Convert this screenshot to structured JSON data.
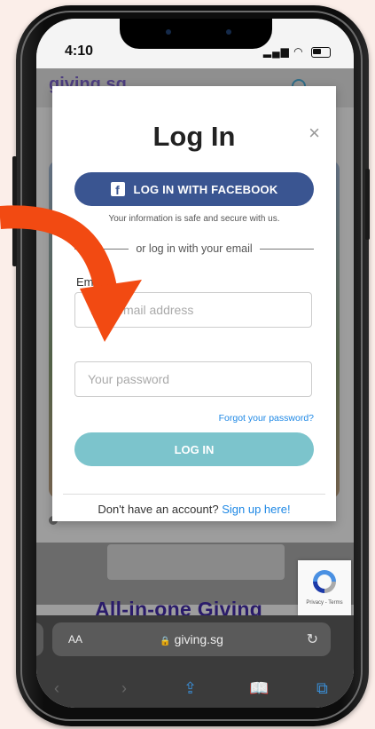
{
  "status_bar": {
    "time": "4:10"
  },
  "site": {
    "logo_text": "giving.sg",
    "headline": "All-in-one Giving"
  },
  "modal": {
    "title": "Log In",
    "close_symbol": "×",
    "facebook_button": "LOG IN WITH FACEBOOK",
    "facebook_icon": "f",
    "safe_note": "Your information is safe and secure with us.",
    "divider_text": "or log in with your email",
    "email_label": "Email",
    "email_placeholder": "Your email address",
    "password_placeholder": "Your password",
    "forgot_link": "Forgot your password?",
    "login_button": "LOG IN",
    "signup_prompt": "Don't have an account?",
    "signup_link": "Sign up here!"
  },
  "recaptcha": {
    "text": "Privacy - Terms"
  },
  "browser": {
    "aa_label": "AA",
    "url": "giving.sg"
  },
  "colors": {
    "facebook": "#3a5591",
    "login_button": "#7cc4cc",
    "link": "#1e88e5",
    "arrow": "#f24a12",
    "background": "#fbeee9"
  }
}
